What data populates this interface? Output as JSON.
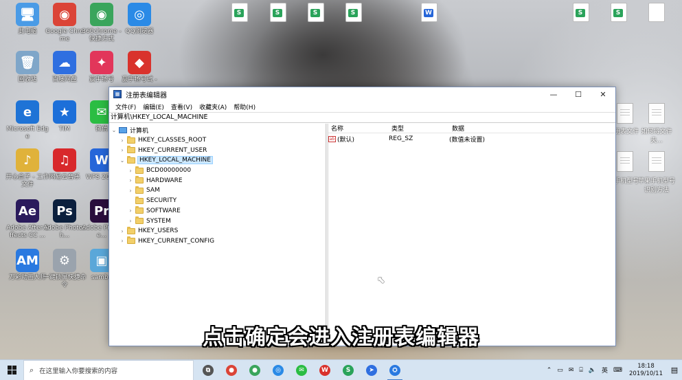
{
  "desktop": {
    "icons": [
      {
        "label": "此电脑",
        "glyph": "🖥",
        "color": "#4a9be6"
      },
      {
        "label": "Google Chrome",
        "glyph": "◉",
        "color": "#db4437"
      },
      {
        "label": "360chrome - 快捷方式",
        "glyph": "◉",
        "color": "#3aa55c"
      },
      {
        "label": "QQ浏览器",
        "glyph": "◎",
        "color": "#2a8ae6"
      },
      {
        "label": "回收站",
        "glyph": "🗑",
        "color": "#7fa6c9"
      },
      {
        "label": "百度网盘",
        "glyph": "☁",
        "color": "#2f6fe0"
      },
      {
        "label": "赢手扬号",
        "glyph": "✦",
        "color": "#e2365a"
      },
      {
        "label": "赢手扬号试 -",
        "glyph": "◆",
        "color": "#d9322c"
      },
      {
        "label": "Microsoft Edge",
        "glyph": "e",
        "color": "#1e73d6"
      },
      {
        "label": "TIM",
        "glyph": "★",
        "color": "#1c6fd9"
      },
      {
        "label": "微信",
        "glyph": "✉",
        "color": "#2bbd43"
      },
      {
        "label": "开心盒子 - 工作文件",
        "glyph": "♪",
        "color": "#e0b23a"
      },
      {
        "label": "网易云音乐",
        "glyph": "♫",
        "color": "#d8282b"
      },
      {
        "label": "WPS 2019",
        "glyph": "W",
        "color": "#2666d9"
      },
      {
        "label": "Adobe After Effects CC ...",
        "glyph": "Ae",
        "color": "#2a1a5c"
      },
      {
        "label": "Adobe Photosh...",
        "glyph": "Ps",
        "color": "#0b1f3d"
      },
      {
        "label": "Adobe Premie...",
        "glyph": "Pr",
        "color": "#2a0d3d"
      },
      {
        "label": "万彩动画大师",
        "glyph": "AM",
        "color": "#2a79e0"
      },
      {
        "label": "一键锁屏快捷命令",
        "glyph": "⚙",
        "color": "#9aa3ad"
      },
      {
        "label": "samba",
        "glyph": "▣",
        "color": "#5aa7d9"
      }
    ],
    "side_docs": [
      {
        "label": "...册表文件"
      },
      {
        "label": "如何将文件夹..."
      },
      {
        "label": "...手机型号"
      },
      {
        "label": "苹果手机型号 识别方法"
      }
    ]
  },
  "window": {
    "title": "注册表编辑器",
    "minimize": "—",
    "maximize": "☐",
    "close": "✕",
    "menu": [
      "文件(F)",
      "编辑(E)",
      "查看(V)",
      "收藏夹(A)",
      "帮助(H)"
    ],
    "address": "计算机\\HKEY_LOCAL_MACHINE",
    "tree": {
      "root": "计算机",
      "top_keys": {
        "classes_root": "HKEY_CLASSES_ROOT",
        "current_user": "HKEY_CURRENT_USER",
        "local_machine": "HKEY_LOCAL_MACHINE",
        "users": "HKEY_USERS",
        "current_config": "HKEY_CURRENT_CONFIG"
      },
      "local_machine_children": [
        "BCD00000000",
        "HARDWARE",
        "SAM",
        "SECURITY",
        "SOFTWARE",
        "SYSTEM"
      ]
    },
    "values": {
      "columns": {
        "name": "名称",
        "type": "类型",
        "data": "数据"
      },
      "rows": [
        {
          "name": "(默认)",
          "type": "REG_SZ",
          "data": "(数值未设置)"
        }
      ]
    }
  },
  "subtitle": "点击确定会进入注册表编辑器",
  "taskbar": {
    "search_placeholder": "在这里输入你要搜索的内容",
    "apps": [
      {
        "name": "task-view",
        "glyph": "⧉",
        "color": "#555555"
      },
      {
        "name": "chrome",
        "glyph": "●",
        "color": "#db4437"
      },
      {
        "name": "360chrome",
        "glyph": "●",
        "color": "#3aa55c"
      },
      {
        "name": "qq-browser",
        "glyph": "◎",
        "color": "#2a8ae6"
      },
      {
        "name": "wechat",
        "glyph": "✉",
        "color": "#2bbd43"
      },
      {
        "name": "wps",
        "glyph": "W",
        "color": "#d9322c"
      },
      {
        "name": "spreadsheet",
        "glyph": "S",
        "color": "#2aa35a"
      },
      {
        "name": "pointer-app",
        "glyph": "➤",
        "color": "#2f6fe0"
      },
      {
        "name": "registry",
        "glyph": "⛭",
        "color": "#2a79e0"
      }
    ],
    "ime": "英",
    "time": "18:18",
    "date": "2019/10/11"
  },
  "colors": {
    "selection": "#cce8ff",
    "folder": "#f2cf6a",
    "taskbar": "#d6e4f2"
  }
}
